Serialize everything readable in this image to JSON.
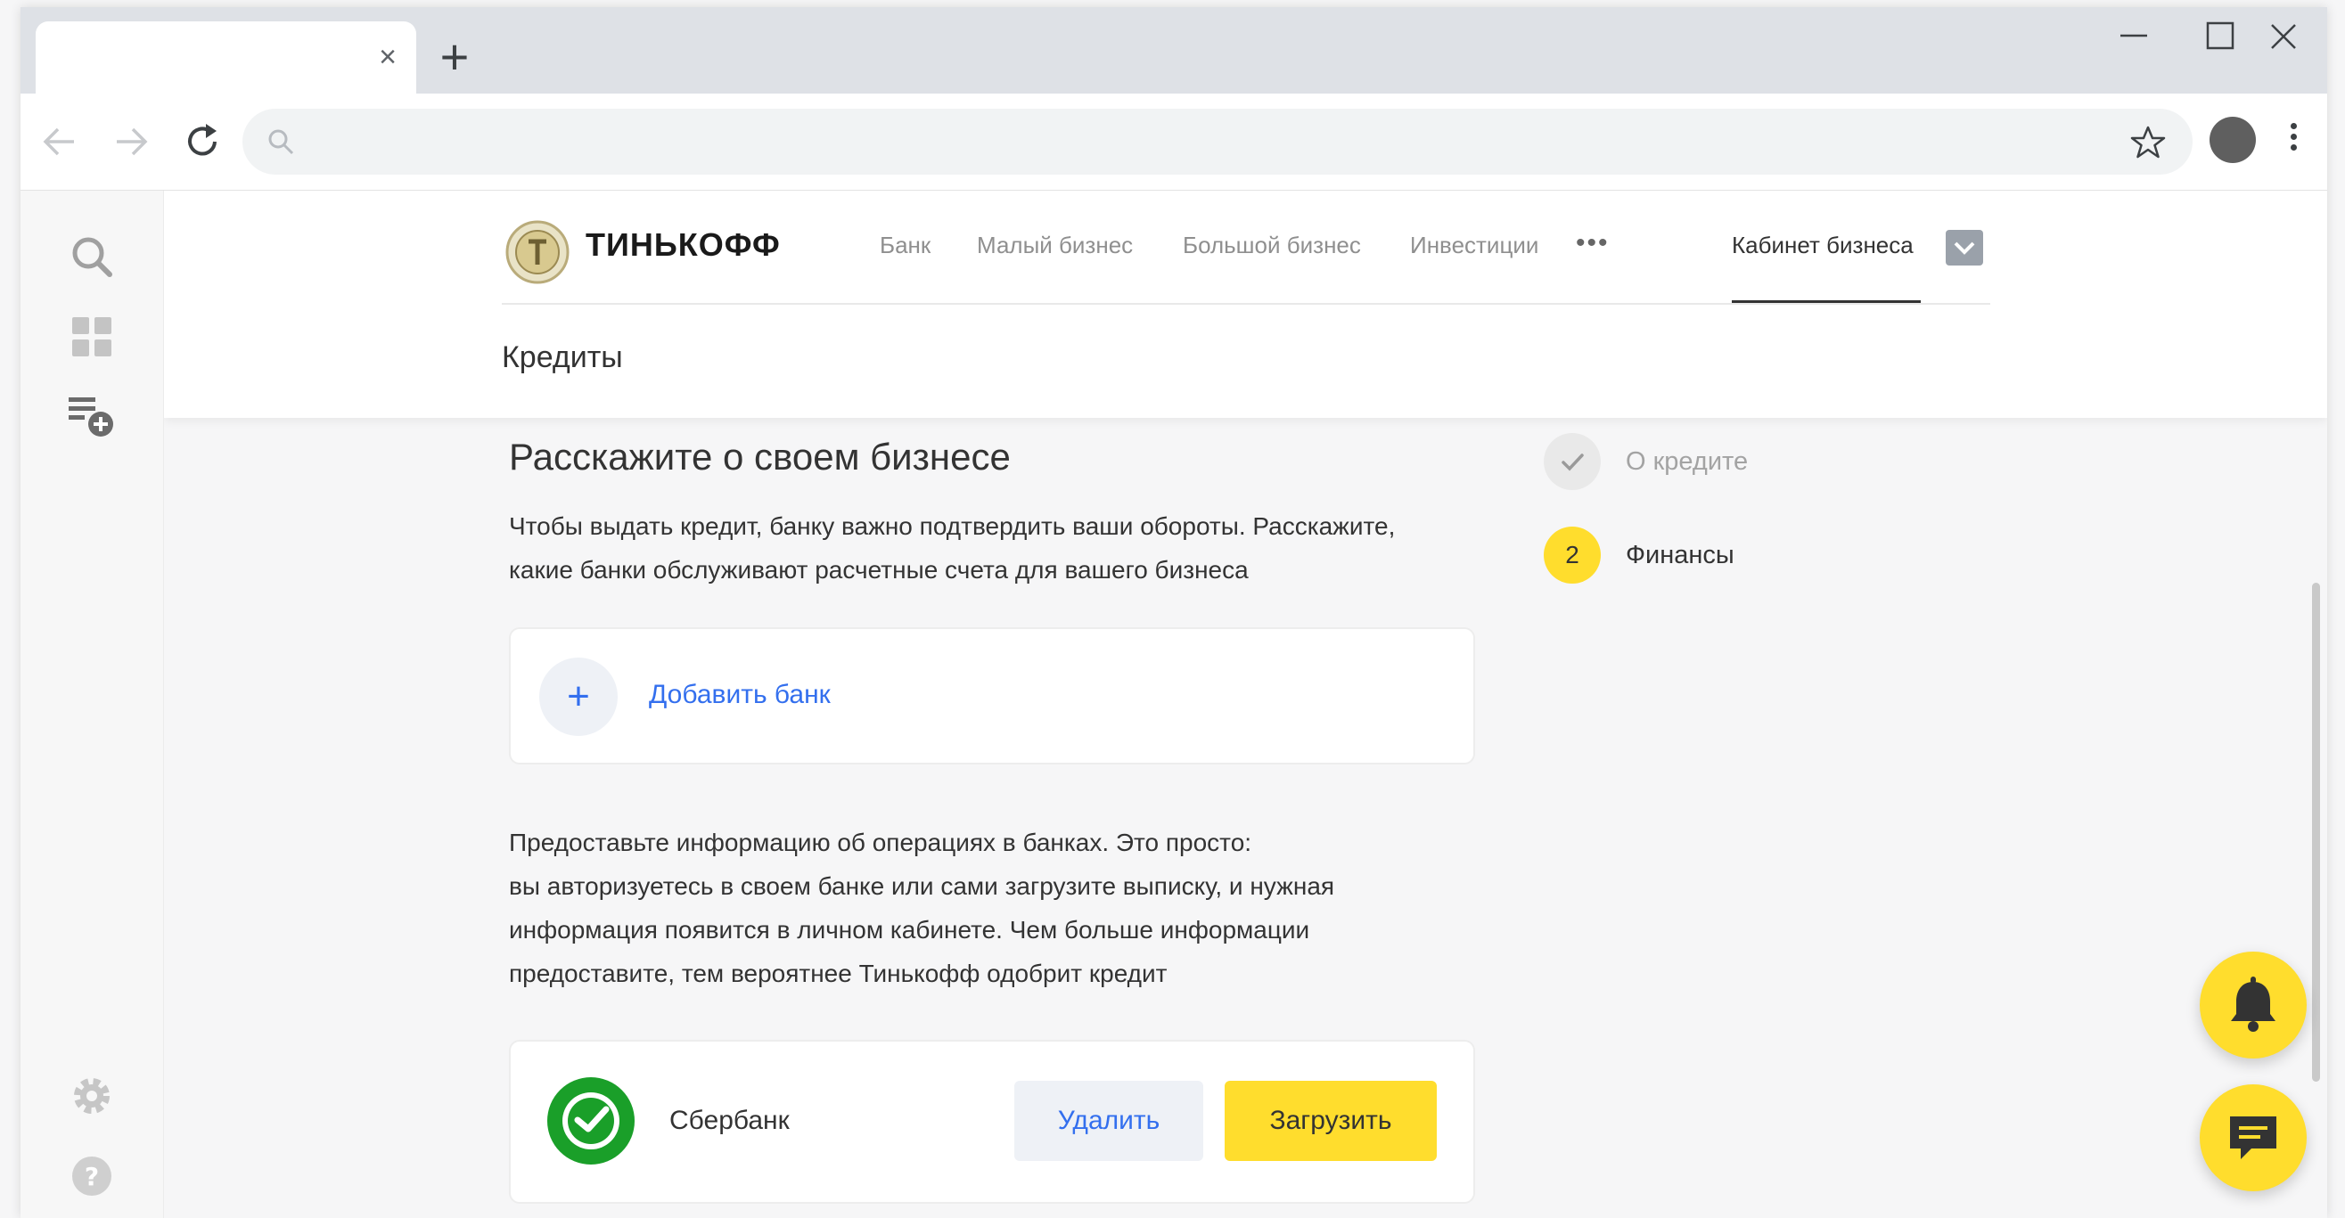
{
  "browser": {
    "tab_close_glyph": "×",
    "new_tab_glyph": "+",
    "window_controls": [
      "minimize-icon",
      "maximize-icon",
      "close-icon"
    ],
    "toolbar_icons": [
      "back-arrow-icon",
      "forward-arrow-icon",
      "reload-icon",
      "search-icon",
      "star-icon",
      "profile-avatar",
      "more-vertical-icon"
    ]
  },
  "app_sidebar": {
    "icons": [
      "search-icon",
      "apps-grid-icon",
      "add-playlist-icon",
      "gear-icon",
      "help-icon"
    ]
  },
  "site": {
    "brand": "ТИНЬКОФФ",
    "nav": [
      "Банк",
      "Малый бизнес",
      "Большой бизнес",
      "Инвестиции"
    ],
    "nav_more": "•••",
    "nav_active": "Кабинет бизнеса",
    "section": "Кредиты"
  },
  "form": {
    "title": "Расскажите о своем бизнесе",
    "lead_line1": "Чтобы выдать кредит, банку важно подтвердить ваши обороты. Расскажите,",
    "lead_line2": "какие банки обслуживают расчетные счета для вашего бизнеса",
    "add_bank_plus": "+",
    "add_bank_label": "Добавить банк",
    "info_line1": "Предоставьте информацию об операциях в банках. Это просто:",
    "info_line2": "вы авторизуетесь в своем банке или сами загрузите выписку, и нужная",
    "info_line3": "информация появится в личном кабинете. Чем больше информации",
    "info_line4": "предоставите, тем вероятнее Тинькофф одобрит кредит",
    "bank": {
      "name": "Сбербанк",
      "delete_label": "Удалить",
      "upload_label": "Загрузить"
    }
  },
  "steps": [
    {
      "label": "О кредите",
      "status": "done",
      "icon": "check-icon"
    },
    {
      "number": "2",
      "label": "Финансы",
      "status": "current"
    }
  ],
  "colors": {
    "accent_yellow": "#ffdd2d",
    "link_blue": "#336fee",
    "sber_green": "#1a9f29"
  },
  "fabs": [
    "bell-icon",
    "chat-icon"
  ]
}
